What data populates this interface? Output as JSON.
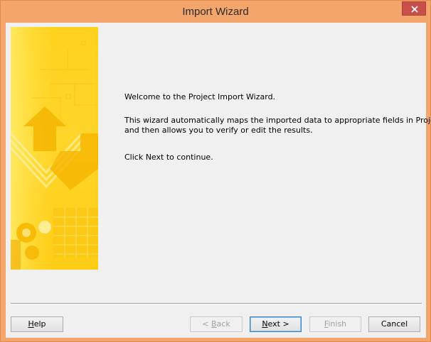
{
  "window": {
    "title": "Import Wizard"
  },
  "content": {
    "welcome": "Welcome to the Project Import Wizard.",
    "description_line1": "This wizard automatically maps the imported data to appropriate fields in Project,",
    "description_line2": "and then allows you to verify or edit the results.",
    "instruction": "Click Next to continue."
  },
  "buttons": {
    "help": {
      "mnemonic": "H",
      "rest": "elp"
    },
    "back": {
      "prefix": "< ",
      "mnemonic": "B",
      "rest": "ack"
    },
    "next": {
      "mnemonic": "N",
      "rest": "ext >"
    },
    "finish": {
      "mnemonic": "F",
      "rest": "inish"
    },
    "cancel": "Cancel"
  },
  "colors": {
    "titlebar": "#f4a56b",
    "close_button": "#c7504b",
    "client_background": "#f0f0f0",
    "image_primary": "#ffd21e",
    "image_accent": "#f5b400"
  },
  "icons": {
    "close": "close-icon",
    "side_image": "wizard-banner-image"
  }
}
